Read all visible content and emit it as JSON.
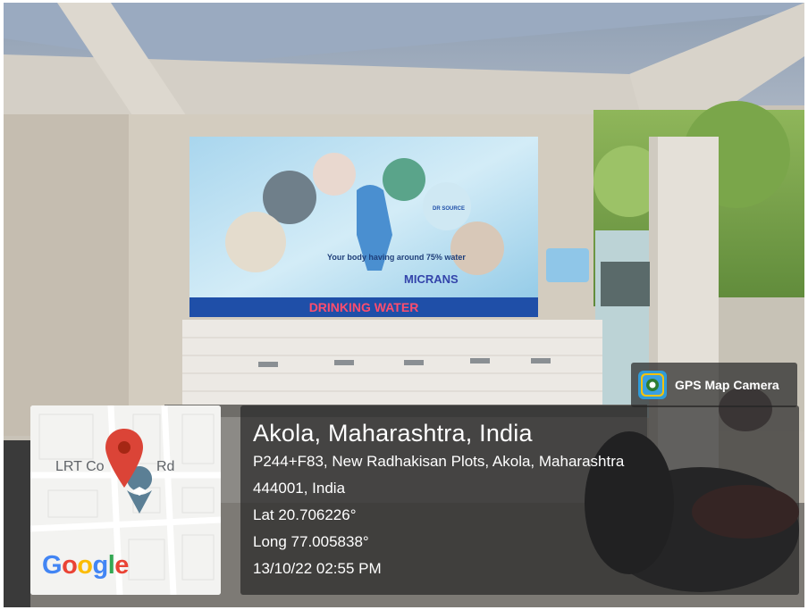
{
  "photo": {
    "banner_text": "DRINKING WATER",
    "banner_body_text": "Your body having around 75% water",
    "banner_logo_text": "MICRANS",
    "banner_badge_text": "DR SOURCE"
  },
  "gps_badge": {
    "app_name": "GPS Map Camera",
    "icon": "gps-map-camera-app-icon"
  },
  "map": {
    "road_label_left": "LRT Co",
    "road_label_right": "Rd",
    "logo": "Google",
    "pin_icon": "location-pin-icon",
    "colors": {
      "pin": "#db4437",
      "blue": "#4285f4",
      "red": "#ea4335",
      "yellow": "#fbbc05",
      "green": "#34a853"
    }
  },
  "location": {
    "city": "Akola, Maharashtra, India",
    "address_line1": "P244+F83, New Radhakisan Plots, Akola, Maharashtra",
    "address_line2": "444001, India",
    "lat": "Lat 20.706226°",
    "long": "Long 77.005838°",
    "datetime": "13/10/22 02:55 PM"
  }
}
